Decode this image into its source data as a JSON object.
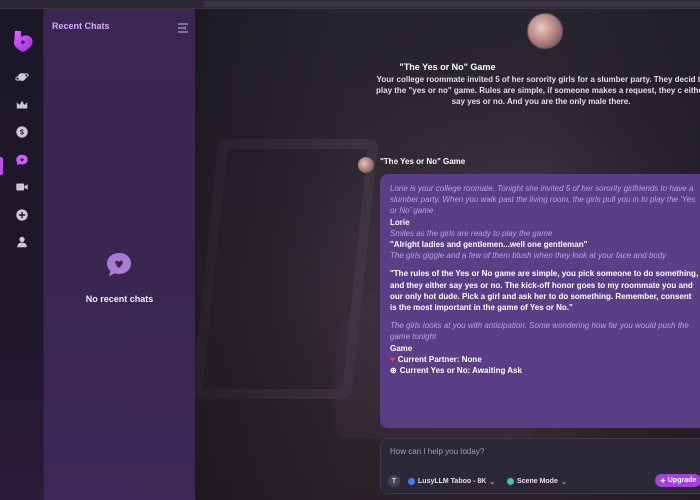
{
  "sidebar": {
    "title": "Recent Chats",
    "empty_text": "No recent chats"
  },
  "header": {
    "title": "\"The Yes or No\" Game",
    "description": "Your college roommate invited 5 of her sorority girls for a slumber party. They decid to play the \"yes or no\" game. Rules are simple, if someone makes a request, they c either say yes or no. And you are the only male there."
  },
  "message": {
    "author": "\"The Yes or No\" Game",
    "lines": [
      {
        "style": "it",
        "text": "Lorie is your college roomate. Tonight she invited 5 of her sorority girlfriends to have a slumber party. When you walk past the living room, the girls pull you in to play the 'Yes or No' game"
      },
      {
        "style": "b",
        "text": "Lorie"
      },
      {
        "style": "it",
        "text": "Smiles as the girls are ready to play the game"
      },
      {
        "style": "b",
        "text": "\"Alright ladies and gentlemen...well one gentleman\""
      },
      {
        "style": "it",
        "text": "The girls giggle and a few of them blush when they look at your face and body"
      },
      {
        "style": "gap",
        "text": ""
      },
      {
        "style": "b",
        "text": "\"The rules of the Yes or No game are simple, you pick someone to do something, and they either say yes or no. The kick-off honor goes to my roommate you and our only hot dude. Pick a girl and ask her to do something. Remember, consent is the most important in the game of Yes or No.\""
      },
      {
        "style": "gap",
        "text": ""
      },
      {
        "style": "it",
        "text": "The girls looks at you with anticipation. Some wondering how far you would push the game tonight"
      },
      {
        "style": "b",
        "text": "Game"
      }
    ],
    "status_partner": "Current Partner: None",
    "status_ask": "Current Yes or No: Awaiting Ask"
  },
  "input": {
    "placeholder": "How can I help you today?",
    "avatar_letter": "T",
    "model_label": "LusyLLM Taboo - 8K",
    "mode_label": "Scene Mode",
    "upgrade_label": "Upgrade"
  },
  "colors": {
    "accent": "#c04cf0",
    "bubble": "#5a3f86",
    "panel": "#3b2752",
    "upgrade": "#a43fe0"
  },
  "icons": [
    "logo-icon",
    "planet-icon",
    "crown-icon",
    "coin-icon",
    "chat-icon",
    "video-icon",
    "plus-circle-icon",
    "user-group-icon",
    "sidebar-toggle-icon",
    "chat-heart-icon",
    "heart-icon",
    "sparkle-icon"
  ]
}
